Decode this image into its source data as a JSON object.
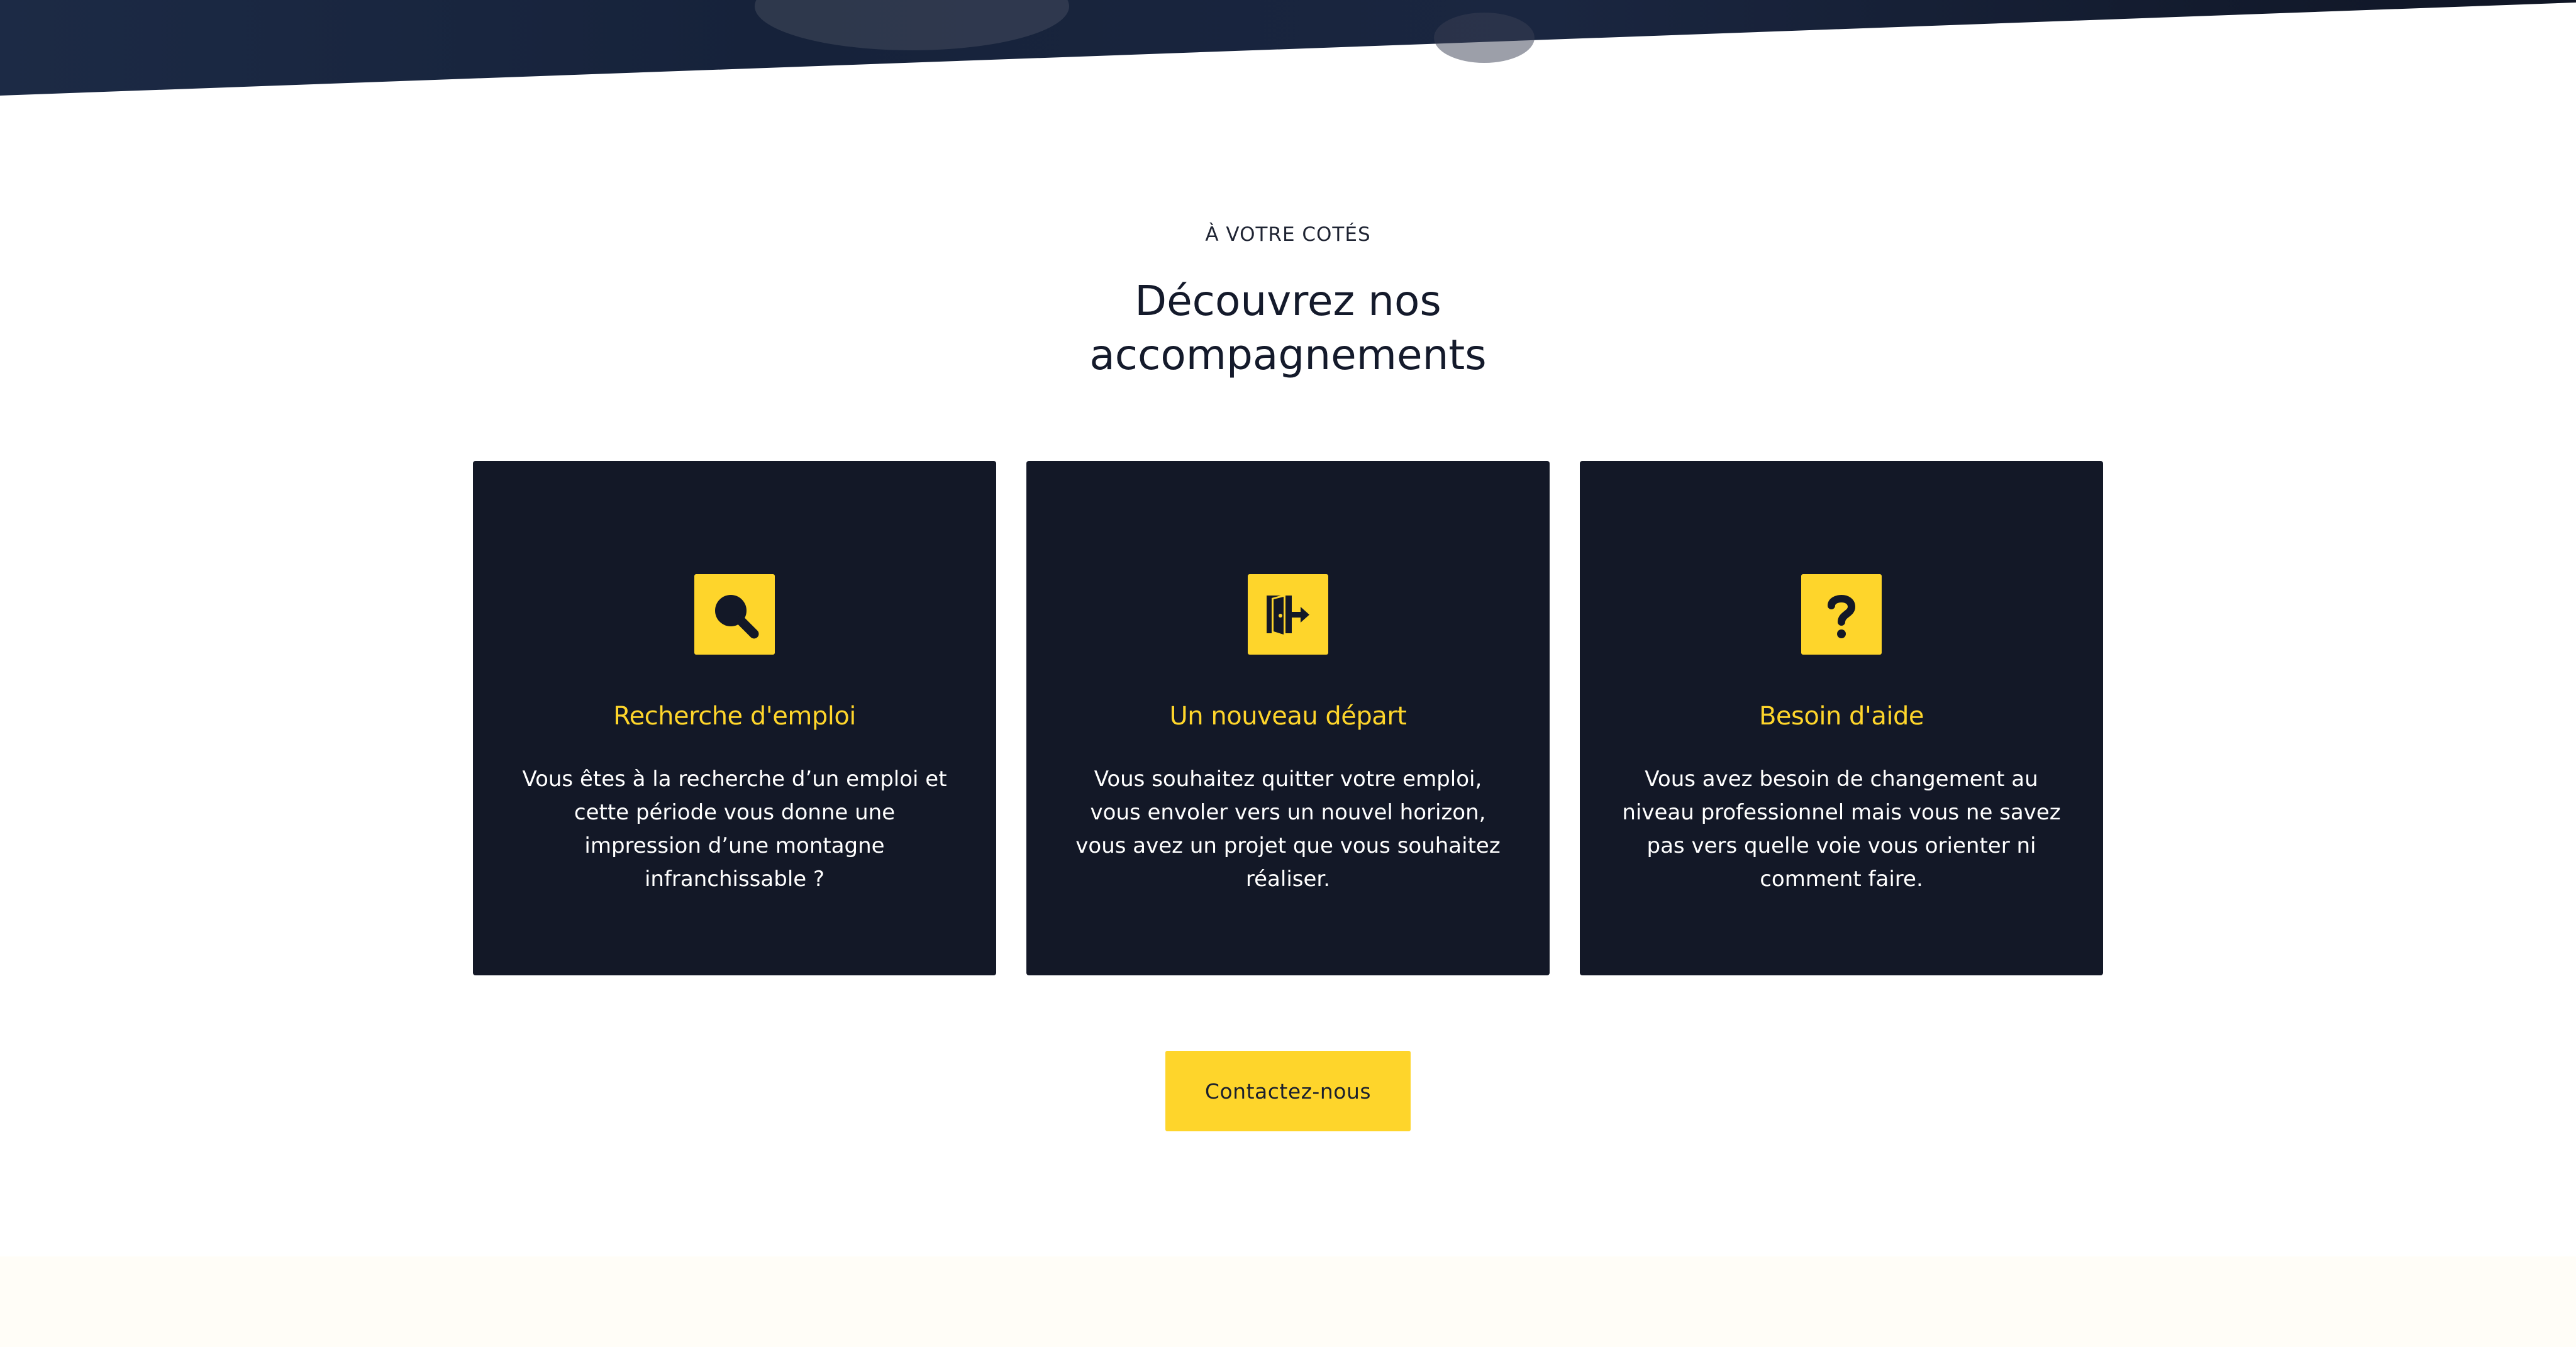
{
  "section": {
    "eyebrow": "À VOTRE COTÉS",
    "heading": "Découvrez nos accompagnements"
  },
  "cards": [
    {
      "icon": "magnifier-icon",
      "title": "Recherche d'emploi",
      "text": "Vous êtes à la recherche d’un emploi et cette période vous donne une impression d’une montagne infranchissable ?"
    },
    {
      "icon": "door-exit-icon",
      "title": "Un nouveau départ",
      "text": "Vous souhaitez quitter votre emploi, vous envoler vers un nouvel horizon, vous avez un projet que vous souhaitez réaliser."
    },
    {
      "icon": "question-mark-icon",
      "title": "Besoin d'aide",
      "text": "Vous avez besoin de changement au niveau professionnel mais vous ne savez pas vers quelle voie vous orienter ni comment faire."
    }
  ],
  "cta": {
    "label": "Contactez-nous"
  },
  "colors": {
    "navy": "#131827",
    "accent_yellow": "#fed52b",
    "white": "#ffffff",
    "cream": "#fffdf7"
  }
}
